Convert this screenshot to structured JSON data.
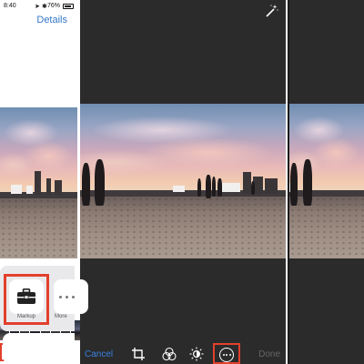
{
  "panel_photos": {
    "status": {
      "time": "8:40",
      "battery": "76%"
    },
    "details_label": "Details",
    "icons": {
      "adjust": "sliders-icon",
      "trash": "trash-icon",
      "signal": "arrow-icon",
      "bluetooth": "bluetooth-icon"
    }
  },
  "panel_edit": {
    "cancel_label": "Cancel",
    "done_label": "Done",
    "icons": [
      "magic-wand-icon",
      "crop-rotate-icon",
      "filters-icon",
      "light-adjust-icon",
      "more-icon"
    ]
  },
  "panel_share": {
    "markup_label": "Markup",
    "more_label": "More",
    "icons": {
      "markup": "toolbox-icon",
      "more": "ellipsis-icon"
    }
  },
  "colors": {
    "highlight": "#e2402d",
    "ios_blue": "#3478c8",
    "edit_bg": "#2b2b2b"
  }
}
